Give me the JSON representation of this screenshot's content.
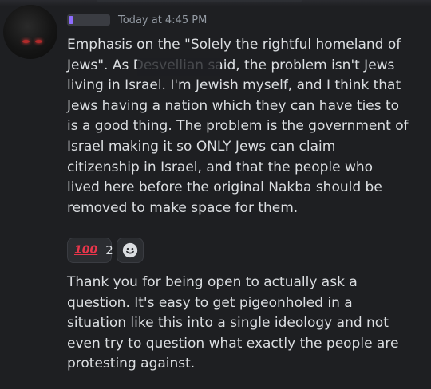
{
  "header": {
    "timestamp": "Today at 4:45 PM"
  },
  "messages": [
    {
      "text": "Emphasis on the \"Solely the rightful homeland of\nJews\". As Desvellian said, the problem isn't Jews\nliving in Israel. I'm Jewish myself, and I think that\nJews having a nation which they can have ties to\nis a good thing. The problem is the government of\nIsrael making it so ONLY Jews can claim\ncitizenship in Israel, and that the people who\nlived here before the original Nakba should be\nremoved to make space for them."
    },
    {
      "text": "Thank you for being open to actually ask a\nquestion. It's easy to get pigeonholed in a\nsituation like this into a single ideology and not\neven try to question what exactly the people are\nprotesting against."
    }
  ],
  "reactions": [
    {
      "emoji": "100",
      "icon": "hundred-points-icon",
      "count": "2",
      "color": "#e8364b"
    }
  ],
  "add_reaction": {
    "icon": "smiley-add-reaction-icon"
  }
}
